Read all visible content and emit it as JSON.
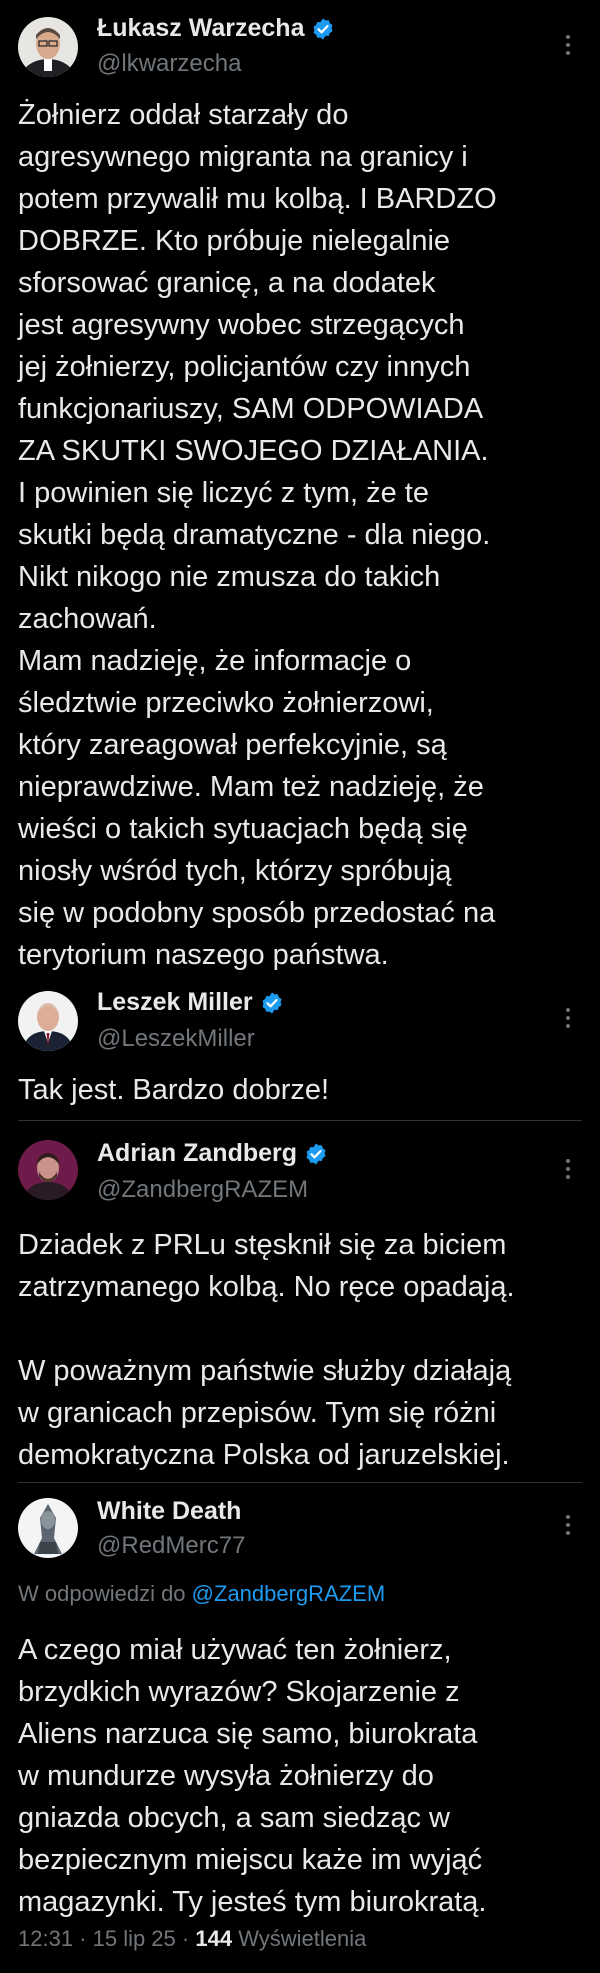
{
  "tweets": [
    {
      "name": "Łukasz Warzecha",
      "handle": "@lkwarzecha",
      "text": "Żołnierz oddał starzały do\nagresywnego migranta na granicy i\npotem przywalił mu kolbą. I BARDZO\nDOBRZE. Kto próbuje nielegalnie\nsforsować granicę, a na dodatek\njest agresywny wobec strzegących\njej żołnierzy, policjantów czy innych\nfunkcjonariuszy, SAM ODPOWIADA\nZA SKUTKI SWOJEGO DZIAŁANIA.\nI powinien się liczyć z tym, że te\nskutki będą dramatyczne - dla niego.\nNikt nikogo nie zmusza do takich\nzachowań.\nMam nadzieję, że informacje o\nśledztwie przeciwko żołnierzowi,\nktóry zareagował perfekcyjnie, są\nnieprawdziwe. Mam też nadzieję, że\nwieści o takich sytuacjach będą się\nniosły wśród tych, którzy spróbują\nsię w podobny sposób przedostać na\nterytorium naszego państwa."
    },
    {
      "name": "Leszek Miller",
      "handle": "@LeszekMiller",
      "text": "Tak jest. Bardzo dobrze!"
    },
    {
      "name": "Adrian Zandberg",
      "handle": "@ZandbergRAZEM",
      "text": "Dziadek z PRLu stęsknił się za biciem\nzatrzymanego kolbą. No ręce opadają.\n\nW poważnym państwie służby działają\nw granicach przepisów. Tym się różni\ndemokratyczna Polska od jaruzelskiej."
    },
    {
      "name": "White Death",
      "handle": "@RedMerc77",
      "reply_prefix": "W odpowiedzi do",
      "reply_mention": "@ZandbergRAZEM",
      "text": "A czego miał używać ten żołnierz,\nbrzydkich wyrazów? Skojarzenie z\nAliens narzuca się samo, biurokrata\nw mundurze wysyła żołnierzy do\ngniazda obcych, a sam siedząc w\nbezpiecznym miejscu każe im wyjąć\nmagazynki. Ty jesteś tym biurokratą.",
      "time": "12:31 · 15 lip 25 ·",
      "views_count": "144",
      "views_label": "Wyświetlenia"
    }
  ],
  "colors": {
    "background": "#000000",
    "text": "#e7e9ea",
    "secondary": "#71767b",
    "accent": "#1d9bf0"
  },
  "icons": {
    "verified": "verified-badge-icon",
    "more": "more-options-icon"
  }
}
